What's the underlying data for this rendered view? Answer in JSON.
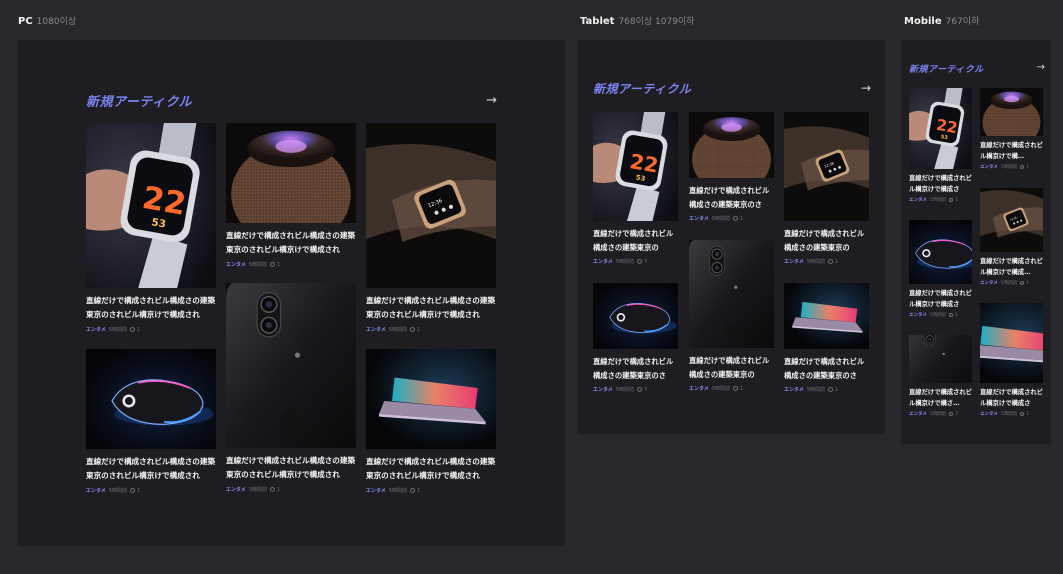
{
  "breakpoints": {
    "pc": {
      "name": "PC",
      "range": "1080이상"
    },
    "tablet": {
      "name": "Tablet",
      "range": "768이상 1079이하"
    },
    "mobile": {
      "name": "Mobile",
      "range": "767이하"
    }
  },
  "section": {
    "title": "新規アーティクル",
    "more_icon": "arrow-right-icon"
  },
  "colors": {
    "background": "#28272b",
    "panel": "#1e1d22",
    "accent": "#7d82f0",
    "category": "#8a8ef6"
  },
  "pc": {
    "articles": [
      {
        "image": "watch-22",
        "title": "直線だけで構成されビル構成さの建築東京のされビル構京けで構成され",
        "category": "エンタメ",
        "time": "5時間前",
        "comments": "1"
      },
      {
        "image": "homepod",
        "title": "直線だけで構成されビル構成さの建築東京のされビル構京けで構成され",
        "category": "エンタメ",
        "time": "5時間前",
        "comments": "1"
      },
      {
        "image": "watch-wrist",
        "title": "直線だけで構成されビル構成さの建築東京のされビル構京けで構成され",
        "category": "エンタメ",
        "time": "5時間前",
        "comments": "1"
      },
      {
        "image": "iphone",
        "title": "直線だけで構成されビル構成さの建築東京のされビル構京けで構成され",
        "category": "エンタメ",
        "time": "5時間前",
        "comments": "1"
      },
      {
        "image": "mouse",
        "title": "直線だけで構成されビル構成さの建築東京のされビル構京けで構成され",
        "category": "エンタメ",
        "time": "5時間前",
        "comments": "1"
      },
      {
        "image": "laptop",
        "title": "直線だけで構成されビル構成さの建築東京のされビル構京けで構成され",
        "category": "エンタメ",
        "time": "5時間前",
        "comments": "1"
      }
    ]
  },
  "tablet": {
    "articles": [
      {
        "image": "watch-22",
        "title": "直線だけで構成されビル構成さの建築東京の",
        "category": "エンタメ",
        "time": "5時間前",
        "comments": "7"
      },
      {
        "image": "homepod",
        "title": "直線だけで構成されビル構成さの建築東京のさ",
        "category": "エンタメ",
        "time": "5時間前",
        "comments": "1"
      },
      {
        "image": "watch-wrist",
        "title": "直線だけで構成されビル構成さの建築東京の",
        "category": "エンタメ",
        "time": "5時間前",
        "comments": "1"
      },
      {
        "image": "iphone",
        "title": "直線だけで構成されビル構成さの建築東京の",
        "category": "エンタメ",
        "time": "5時間前",
        "comments": "1"
      },
      {
        "image": "mouse",
        "title": "直線だけで構成されビル構成さの建築東京のさ",
        "category": "エンタメ",
        "time": "5時間前",
        "comments": "7"
      },
      {
        "image": "laptop",
        "title": "直線だけで構成されビル構成さの建築東京のさ",
        "category": "エンタメ",
        "time": "5時間前",
        "comments": "1"
      }
    ]
  },
  "mobile": {
    "articles": [
      {
        "image": "watch-22",
        "title": "直線だけで構成されビル構京けで構成さ",
        "category": "エンタメ",
        "time": "5時間前",
        "comments": "1"
      },
      {
        "image": "homepod",
        "title": "直線だけで構成されビル構京けで構…",
        "category": "エンタメ",
        "time": "5時間前",
        "comments": "1"
      },
      {
        "image": "watch-wrist",
        "title": "直線だけで構成されビル構京けで構成…",
        "category": "エンタメ",
        "time": "5時間前",
        "comments": "1"
      },
      {
        "image": "mouse",
        "title": "直線だけで構成されビル構京けで構成さ",
        "category": "エンタメ",
        "time": "5時間前",
        "comments": "1"
      },
      {
        "image": "iphone",
        "title": "直線だけで構成されビル構京けで構さ…",
        "category": "エンタメ",
        "time": "5時間前",
        "comments": "7"
      },
      {
        "image": "laptop",
        "title": "直線だけで構成されビル構京けで構成さ",
        "category": "エンタメ",
        "time": "5時間前",
        "comments": "1"
      }
    ]
  }
}
